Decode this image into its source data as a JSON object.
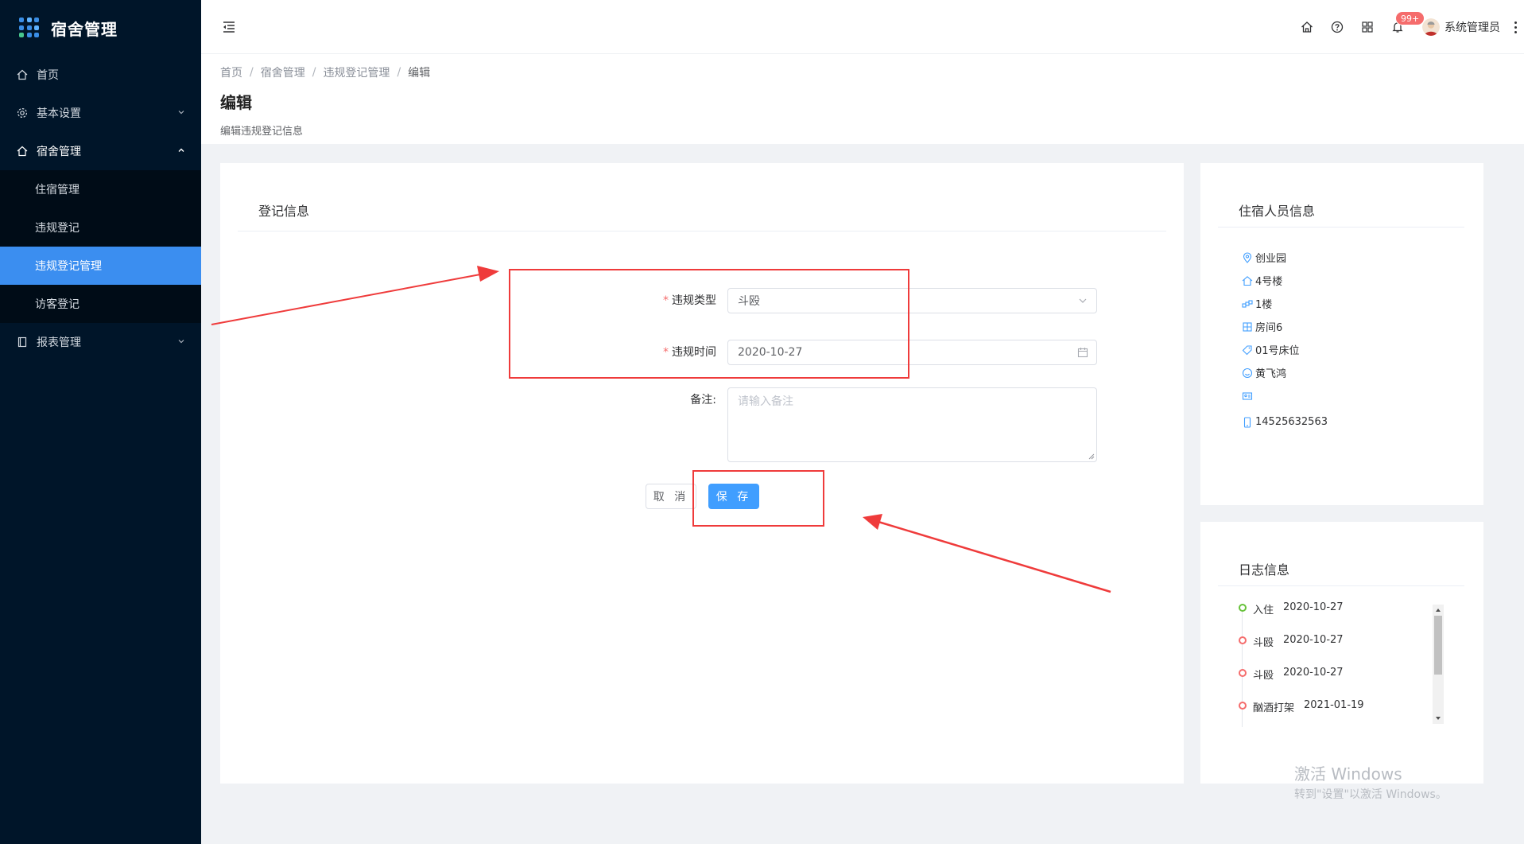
{
  "app": {
    "title": "宿舍管理"
  },
  "sidebar": {
    "items": [
      {
        "label": "首页",
        "icon": "home-icon"
      },
      {
        "label": "基本设置",
        "icon": "gear-icon"
      },
      {
        "label": "宿舍管理",
        "icon": "home-icon"
      },
      {
        "label": "报表管理",
        "icon": "document-icon"
      }
    ],
    "submenu": [
      {
        "label": "住宿管理"
      },
      {
        "label": "违规登记"
      },
      {
        "label": "违规登记管理"
      },
      {
        "label": "访客登记"
      }
    ]
  },
  "header": {
    "badge": "99+",
    "user_name": "系统管理员"
  },
  "breadcrumb": [
    "首页",
    "宿舍管理",
    "违规登记管理",
    "编辑"
  ],
  "page": {
    "title": "编辑",
    "desc": "编辑违规登记信息"
  },
  "form": {
    "card_title": "登记信息",
    "type_label": "违规类型",
    "type_value": "斗殴",
    "time_label": "违规时间",
    "time_value": "2020-10-27",
    "note_label": "备注:",
    "note_placeholder": "请输入备注",
    "cancel_label": "取 消",
    "save_label": "保 存"
  },
  "resident": {
    "title": "住宿人员信息",
    "items": [
      {
        "icon": "location-icon",
        "text": "创业园"
      },
      {
        "icon": "building-icon",
        "text": "4号楼"
      },
      {
        "icon": "floor-icon",
        "text": "1楼"
      },
      {
        "icon": "room-icon",
        "text": "房间6"
      },
      {
        "icon": "tag-icon",
        "text": "01号床位"
      },
      {
        "icon": "smile-icon",
        "text": "黄飞鸿"
      },
      {
        "icon": "id-card-icon",
        "text": ""
      },
      {
        "icon": "phone-icon",
        "text": "14525632563"
      }
    ]
  },
  "log": {
    "title": "日志信息",
    "items": [
      {
        "action": "入住",
        "date": "2020-10-27",
        "color": "#67c23a"
      },
      {
        "action": "斗殴",
        "date": "2020-10-27",
        "color": "#f56c6c"
      },
      {
        "action": "斗殴",
        "date": "2020-10-27",
        "color": "#f56c6c"
      },
      {
        "action": "酗酒打架",
        "date": "2021-01-19",
        "color": "#f56c6c"
      }
    ]
  },
  "watermark": {
    "line1": "激活 Windows",
    "line2": "转到\"设置\"以激活 Windows。"
  },
  "colors": {
    "sidebar_bg": "#001529",
    "accent": "#409eff",
    "annotation": "#ef3b3b"
  }
}
